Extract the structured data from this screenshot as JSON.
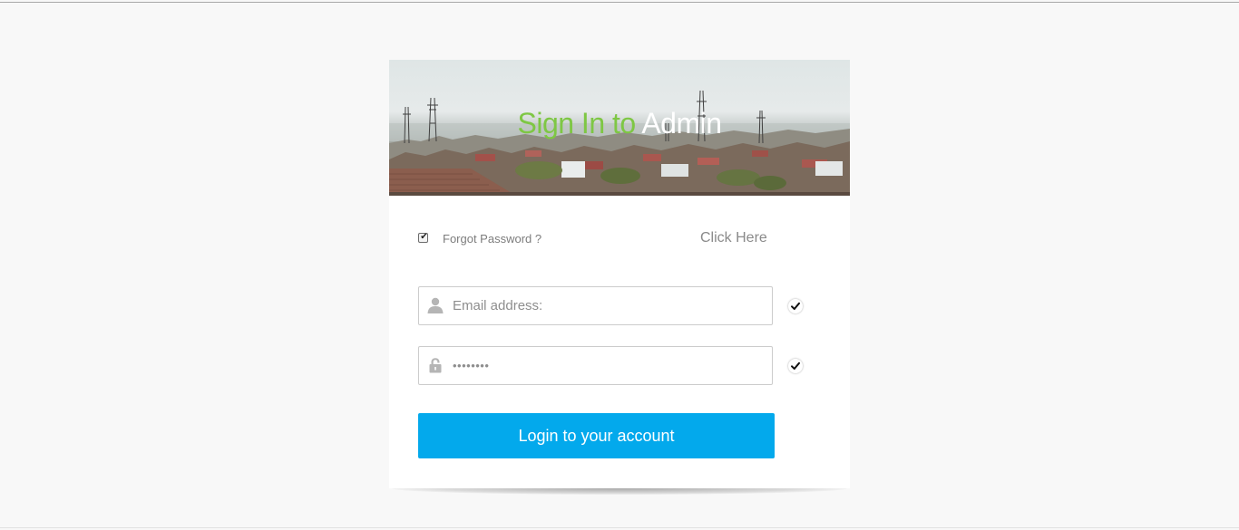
{
  "banner": {
    "title_part1": "Sign In to",
    "title_part2": "Admin"
  },
  "remember": {
    "checked": true,
    "label": "Forgot Password ?",
    "link_label": "Click Here"
  },
  "email": {
    "placeholder": "Email address:",
    "icon": "user-icon"
  },
  "password": {
    "value": "********",
    "icon": "lock-icon"
  },
  "login_button_label": "Login to your account",
  "colors": {
    "accent_blue": "#03a9ec",
    "title_green": "#7ec744",
    "page_background": "#f8f8f8"
  }
}
